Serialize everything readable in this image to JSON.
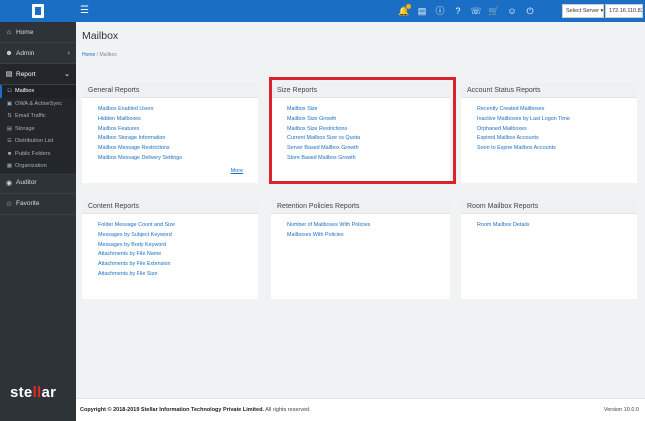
{
  "topbar": {
    "server_select": "Select Server ▾",
    "server_ip": "172.16.110.83",
    "icons": [
      "bell-icon",
      "document-icon",
      "info-icon",
      "help-icon",
      "support-icon",
      "cart-icon",
      "user-icon",
      "power-icon"
    ]
  },
  "sidebar": {
    "items": [
      {
        "label": "Home",
        "icon": "home-icon"
      },
      {
        "label": "Admin",
        "icon": "user-icon"
      },
      {
        "label": "Report",
        "icon": "report-icon"
      }
    ],
    "sub_items": [
      {
        "label": "Mailbox"
      },
      {
        "label": "OWA & ActiveSync"
      },
      {
        "label": "Email Traffic"
      },
      {
        "label": "Storage"
      },
      {
        "label": "Distribution List"
      },
      {
        "label": "Public Folders"
      },
      {
        "label": "Organization"
      }
    ],
    "bottom_items": [
      {
        "label": "Auditor"
      },
      {
        "label": "Favorite"
      }
    ],
    "brand": {
      "pre": "ste",
      "mid": "ll",
      "post": "ar"
    }
  },
  "page": {
    "title": "Mailbox",
    "breadcrumb_home": "Home",
    "breadcrumb_sep": "/",
    "breadcrumb_current": "Mailbox"
  },
  "cards": {
    "general": {
      "title": "General Reports",
      "links": [
        "Mailbox Enabled Users",
        "Hidden Mailboxes",
        "Mailbox Features",
        "Mailbox Storage Information",
        "Mailbox Message Restrictions",
        "Mailbox Message Delivery Settings"
      ],
      "more": "More"
    },
    "size": {
      "title": "Size Reports",
      "links": [
        "Mailbox Size",
        "Mailbox Size Growth",
        "Mailbox Size Restrictions",
        "Current Mailbox Size vs Quota",
        "Server Based Mailbox Growth",
        "Store Based Mailbox Growth"
      ]
    },
    "account": {
      "title": "Account Status Reports",
      "links": [
        "Recently Created Mailboxes",
        "Inactive Mailboxes by Last Logon Time",
        "Orphaned Mailboxes",
        "Expired Mailbox Accounts",
        "Soon to Expire Mailbox Accounts"
      ]
    },
    "content": {
      "title": "Content Reports",
      "links": [
        "Folder Message Count and Size",
        "Messages by Subject Keyword",
        "Messages by Body Keyword",
        "Attachments by File Name",
        "Attachments by File Extension",
        "Attachments by File Size"
      ]
    },
    "retention": {
      "title": "Retention Policies Reports",
      "links": [
        "Number of Mailboxes With Policies",
        "Mailboxes With Policies"
      ]
    },
    "room": {
      "title": "Room Mailbox Reports",
      "links": [
        "Room Mailbox Details"
      ]
    }
  },
  "footer": {
    "copyright_bold": "Copyright © 2018-2019 Stellar Information Technology Private Limited.",
    "copyright_rest": " All rights reserved.",
    "version": "Version 10.0.0"
  },
  "colors": {
    "topbar": "#1a6fc4",
    "sidebar": "#2e3338",
    "highlight": "#d9232d",
    "link": "#1a6fc4"
  }
}
